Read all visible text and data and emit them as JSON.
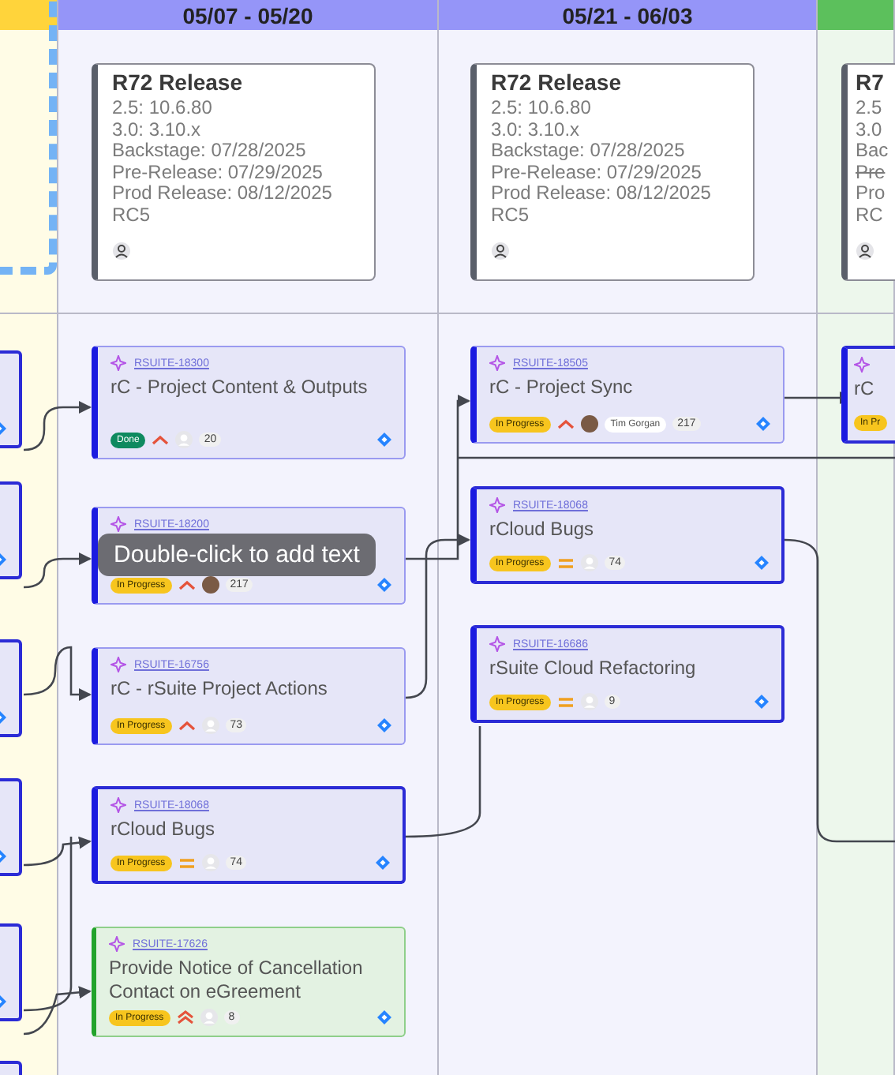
{
  "columns": [
    {
      "color": "#ffd43b",
      "cards": [
        {
          "highlighted": true
        },
        {
          "highlighted": true
        },
        {
          "highlighted": true
        },
        {
          "highlighted": true
        },
        {
          "highlighted": true
        },
        {
          "highlighted": true
        }
      ]
    },
    {
      "color": "#9595f8",
      "header": "05/07 - 05/20",
      "release": {
        "title": "R72 Release",
        "lines": [
          {
            "text": "2.5: 10.6.80",
            "struck": false
          },
          {
            "text": "3.0: 3.10.x",
            "struck": false
          },
          {
            "text": "Backstage: 07/28/2025",
            "struck": false
          },
          {
            "text": "Pre-Release: 07/29/2025",
            "struck": false
          },
          {
            "text": "Prod Release: 08/12/2025",
            "struck": false
          },
          {
            "text": "RC5",
            "struck": false
          }
        ]
      },
      "cards": [
        {
          "key": "RSUITE-18300",
          "title": "rC - Project Content & Outputs",
          "status": {
            "label": "Done",
            "kind": "done"
          },
          "priority": {
            "kind": "high"
          },
          "avatar": {
            "kind": "default"
          },
          "count": "20",
          "highlighted": false,
          "color": "#e6e6f8"
        },
        {
          "key": "RSUITE-18200",
          "status": {
            "label": "In Progress",
            "kind": "progress"
          },
          "priority": {
            "kind": "high"
          },
          "avatar": {
            "kind": "photo"
          },
          "count": "217",
          "highlighted": false,
          "color": "#e6e6f8"
        },
        {
          "key": "RSUITE-16756",
          "title": "rC - rSuite Project Actions",
          "status": {
            "label": "In Progress",
            "kind": "progress"
          },
          "priority": {
            "kind": "high"
          },
          "avatar": {
            "kind": "default"
          },
          "count": "73",
          "highlighted": false,
          "color": "#e6e6f8"
        },
        {
          "key": "RSUITE-18068",
          "title": "rCloud Bugs",
          "status": {
            "label": "In Progress",
            "kind": "progress"
          },
          "priority": {
            "kind": "medium"
          },
          "avatar": {
            "kind": "default"
          },
          "count": "74",
          "highlighted": true,
          "color": "#e6e6f8"
        },
        {
          "key": "RSUITE-17626",
          "title": "Provide Notice of Cancellation Contact on eGreement",
          "status": {
            "label": "In Progress",
            "kind": "progress"
          },
          "priority": {
            "kind": "highest"
          },
          "avatar": {
            "kind": "default"
          },
          "count": "8",
          "color": "#e3f2e2"
        }
      ]
    },
    {
      "color": "#9595f8",
      "header": "05/21 - 06/03",
      "release": {
        "title": "R72 Release",
        "lines": [
          {
            "text": "2.5: 10.6.80",
            "struck": false
          },
          {
            "text": "3.0: 3.10.x",
            "struck": false
          },
          {
            "text": "Backstage: 07/28/2025",
            "struck": false
          },
          {
            "text": "Pre-Release: 07/29/2025",
            "struck": false
          },
          {
            "text": "Prod Release: 08/12/2025",
            "struck": false
          },
          {
            "text": "RC5",
            "struck": false
          }
        ]
      },
      "cards": [
        {
          "key": "RSUITE-18505",
          "title": "rC - Project Sync",
          "status": {
            "label": "In Progress",
            "kind": "progress"
          },
          "priority": {
            "kind": "high"
          },
          "avatar": {
            "kind": "photo"
          },
          "assignee": "Tim Gorgan",
          "count": "217",
          "highlighted": false,
          "color": "#e6e6f8"
        },
        {
          "key": "RSUITE-18068",
          "title": "rCloud Bugs",
          "status": {
            "label": "In Progress",
            "kind": "progress"
          },
          "priority": {
            "kind": "medium"
          },
          "avatar": {
            "kind": "default"
          },
          "count": "74",
          "highlighted": true,
          "color": "#e6e6f8"
        },
        {
          "key": "RSUITE-16686",
          "title": "rSuite Cloud Refactoring",
          "status": {
            "label": "In Progress",
            "kind": "progress"
          },
          "priority": {
            "kind": "medium"
          },
          "avatar": {
            "kind": "default"
          },
          "count": "9",
          "highlighted": true,
          "color": "#e6e6f8"
        }
      ]
    },
    {
      "color": "#5cc05c",
      "release": {
        "title": "R7",
        "lines": [
          {
            "text": "2.5",
            "struck": false
          },
          {
            "text": "3.0",
            "struck": false
          },
          {
            "text": "Bac",
            "struck": false
          },
          {
            "text": "Pre",
            "struck": true
          },
          {
            "text": "Pro",
            "struck": false
          },
          {
            "text": "RC",
            "struck": false
          }
        ]
      },
      "cards": [
        {
          "title": "rC",
          "status": {
            "label": "In Pr",
            "kind": "progress"
          },
          "highlighted": true,
          "color": "#e6e6f8"
        }
      ]
    }
  ],
  "tooltip": "Double-click to add text"
}
